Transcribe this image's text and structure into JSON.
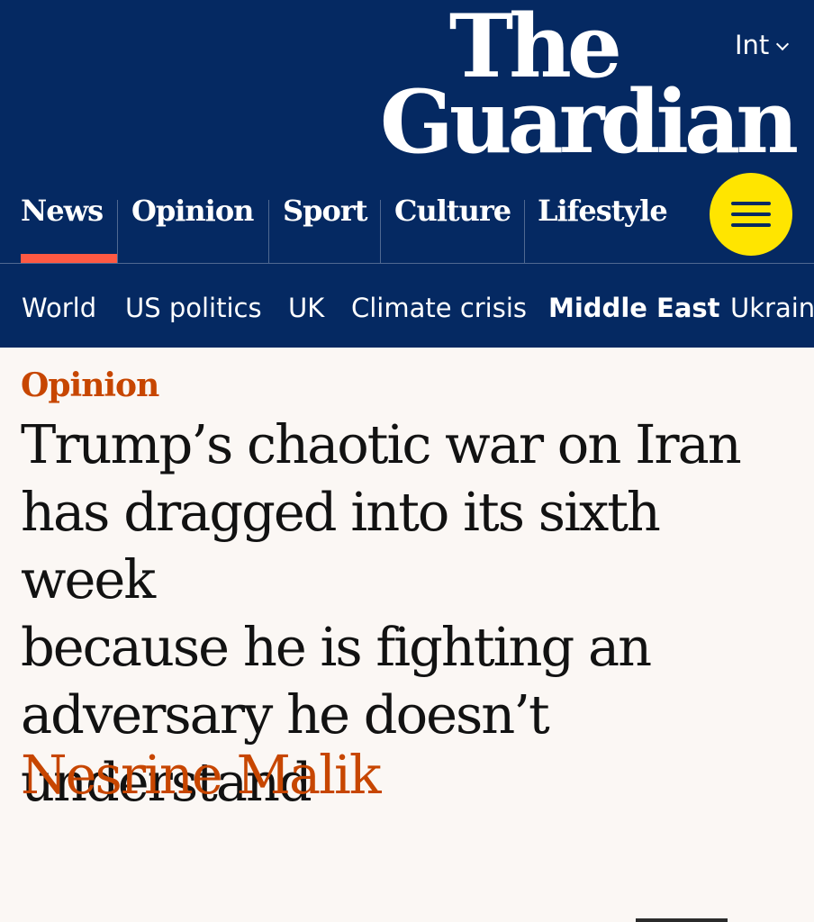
{
  "header": {
    "edition_label": "Int",
    "logo_line1": "The",
    "logo_line2": "Guardian",
    "menu_icon": "hamburger-icon",
    "colors": {
      "background": "#052962",
      "menu_button": "#ffe500",
      "active_underline": "#ff5943"
    }
  },
  "pillars": [
    {
      "label": "News",
      "active": true
    },
    {
      "label": "Opinion"
    },
    {
      "label": "Sport"
    },
    {
      "label": "Culture"
    },
    {
      "label": "Lifestyle"
    }
  ],
  "subnav": [
    {
      "label": "World"
    },
    {
      "label": "US politics"
    },
    {
      "label": "UK"
    },
    {
      "label": "Climate crisis"
    },
    {
      "label": "Middle East",
      "active": true
    },
    {
      "label": "Ukrain"
    }
  ],
  "article": {
    "kicker": "Opinion",
    "headline_lines": [
      "Trump’s chaotic war on Iran",
      "has dragged into its sixth week",
      "because he is fighting an",
      "adversary he doesn’t",
      "understand"
    ],
    "byline": "Nesrine Malik",
    "colors": {
      "kicker": "#c74600",
      "headline": "#121212",
      "byline": "#c74600",
      "page_background": "#fbf7f4"
    }
  }
}
